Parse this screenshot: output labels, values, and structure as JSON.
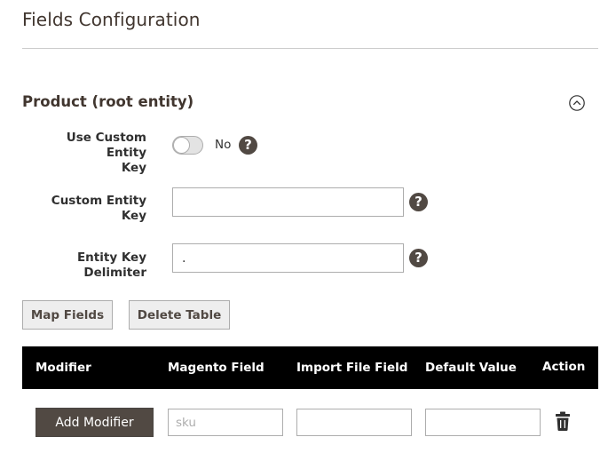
{
  "page": {
    "title": "Fields Configuration"
  },
  "section": {
    "title": "Product (root entity)"
  },
  "fields": {
    "use_custom_entity_key": {
      "label_line1": "Use Custom Entity",
      "label_line2": "Key",
      "toggle_state": "No",
      "enabled": false
    },
    "custom_entity_key": {
      "label": "Custom Entity Key",
      "value": ""
    },
    "entity_key_delimiter": {
      "label": "Entity Key Delimiter",
      "value": "."
    },
    "help_glyph": "?"
  },
  "buttons": {
    "map_fields": "Map Fields",
    "delete_table": "Delete Table",
    "add_modifier": "Add Modifier"
  },
  "table": {
    "columns": [
      "Modifier",
      "Magento Field",
      "Import File Field",
      "Default Value",
      "Action"
    ],
    "rows": [
      {
        "magento_field_placeholder": "sku",
        "import_file_field": "",
        "default_value": ""
      }
    ]
  },
  "icons": {
    "collapse": "chevron-up-icon",
    "help": "help-icon",
    "delete": "trash-icon"
  },
  "colors": {
    "header_bg": "#000000",
    "dark_button": "#514943",
    "help_icon": "#514943",
    "title_text": "#41362f"
  }
}
